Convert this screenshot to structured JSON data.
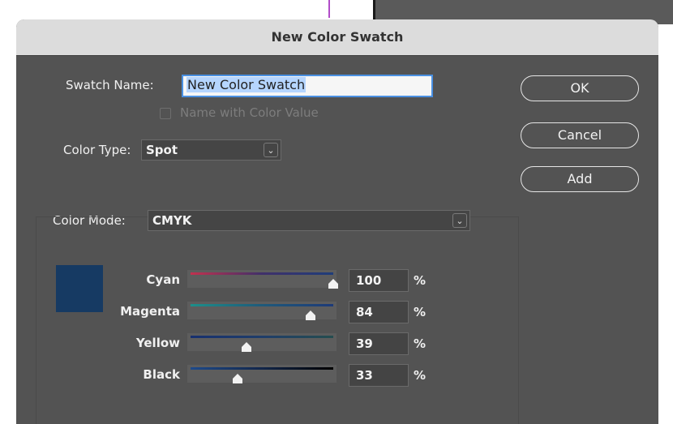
{
  "dialog": {
    "title": "New Color Swatch"
  },
  "swatch_name": {
    "label": "Swatch Name:",
    "value": "New Color Swatch"
  },
  "name_with_color_value": {
    "label": "Name with Color Value",
    "checked": false,
    "enabled": false
  },
  "color_type": {
    "label": "Color Type:",
    "value": "Spot"
  },
  "color_mode": {
    "label": "Color Mode:",
    "value": "CMYK"
  },
  "preview_color": "#163a63",
  "sliders": [
    {
      "label": "Cyan",
      "value": "100",
      "unit": "%",
      "fraction": 1.0
    },
    {
      "label": "Magenta",
      "value": "84",
      "unit": "%",
      "fraction": 0.84
    },
    {
      "label": "Yellow",
      "value": "39",
      "unit": "%",
      "fraction": 0.39
    },
    {
      "label": "Black",
      "value": "33",
      "unit": "%",
      "fraction": 0.33
    }
  ],
  "buttons": {
    "ok": "OK",
    "cancel": "Cancel",
    "add": "Add"
  },
  "icons": {
    "dropdown": "chevron-down-icon"
  }
}
